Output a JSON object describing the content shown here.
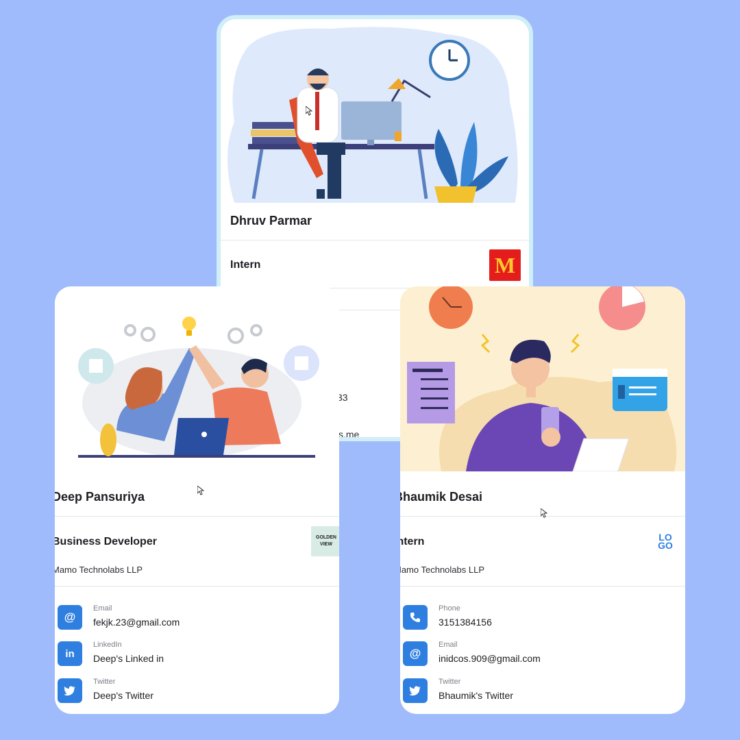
{
  "cards": {
    "top": {
      "name": "Dhruv Parmar",
      "role": "Intern",
      "company_logo_icon": "mcdonalds-logo",
      "company_logo_letter": "M",
      "peek_phone": "33",
      "peek_url": "s.me"
    },
    "left": {
      "name": "Deep Pansuriya",
      "role": "Business Developer",
      "company": "Mamo Technolabs LLP",
      "company_logo_icon": "golden-view-logo",
      "company_logo_text": "GOLDEN VIEW",
      "contacts": [
        {
          "icon": "at-icon",
          "label": "Email",
          "value": "fekjk.23@gmail.com"
        },
        {
          "icon": "linkedin-icon",
          "label": "LinkedIn",
          "value": "Deep's Linked in"
        },
        {
          "icon": "twitter-icon",
          "label": "Twitter",
          "value": "Deep's Twitter"
        }
      ]
    },
    "right": {
      "name": "Bhaumik Desai",
      "role": "Intern",
      "company": "Mamo Technolabs LLP",
      "company_logo_icon": "logo-placeholder",
      "company_logo_text": "LOGO",
      "contacts": [
        {
          "icon": "phone-icon",
          "label": "Phone",
          "value": "3151384156"
        },
        {
          "icon": "at-icon",
          "label": "Email",
          "value": "inidcos.909@gmail.com"
        },
        {
          "icon": "twitter-icon",
          "label": "Twitter",
          "value": "Bhaumik's Twitter"
        }
      ]
    }
  },
  "colors": {
    "background": "#9fbbfb",
    "card": "#ffffff",
    "accent": "#2f7fe0",
    "mcdonalds_red": "#e41c1c",
    "mcdonalds_yellow": "#ffc72c"
  }
}
